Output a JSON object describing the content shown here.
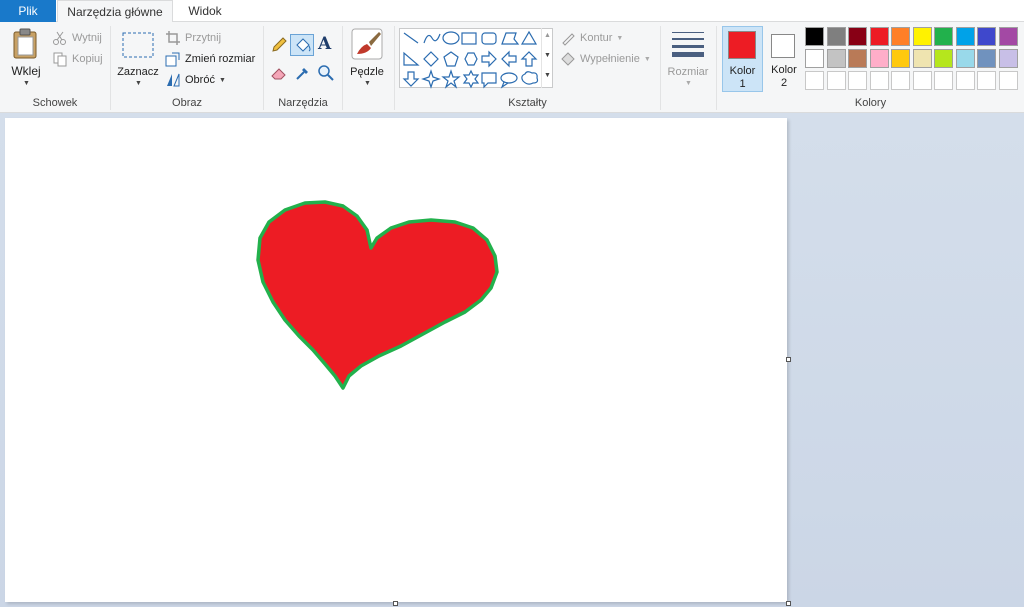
{
  "tabs": {
    "file": "Plik",
    "home": "Narzędzia główne",
    "view": "Widok"
  },
  "clipboard": {
    "paste": "Wklej",
    "cut": "Wytnij",
    "copy": "Kopiuj",
    "group": "Schowek"
  },
  "image": {
    "select": "Zaznacz",
    "crop": "Przytnij",
    "resize": "Zmień rozmiar",
    "rotate": "Obróć",
    "group": "Obraz"
  },
  "tools": {
    "group": "Narzędzia",
    "brushes": "Pędzle"
  },
  "shapes": {
    "outline": "Kontur",
    "fill": "Wypełnienie",
    "group": "Kształty"
  },
  "size": {
    "label": "Rozmiar"
  },
  "colors": {
    "color1_line1": "Kolor",
    "color1_line2": "1",
    "color2_line1": "Kolor",
    "color2_line2": "2",
    "group": "Kolory",
    "color1_value": "#ed1c24",
    "color2_value": "#ffffff",
    "palette_row1": [
      "#000000",
      "#7f7f7f",
      "#880015",
      "#ed1c24",
      "#ff7f27",
      "#fff200",
      "#22b14c",
      "#00a2e8",
      "#3f48cc",
      "#a349a4"
    ],
    "palette_row2": [
      "#ffffff",
      "#c3c3c3",
      "#b97a57",
      "#ffaec9",
      "#ffc90e",
      "#efe4b0",
      "#b5e61d",
      "#99d9ea",
      "#7092be",
      "#c8bfe7"
    ],
    "palette_row3": [
      "#ffffff",
      "#ffffff",
      "#ffffff",
      "#ffffff",
      "#ffffff",
      "#ffffff",
      "#ffffff",
      "#ffffff",
      "#ffffff",
      "#ffffff"
    ]
  },
  "canvas": {
    "drawing": "heart",
    "fill_color": "#ed1c24",
    "outline_color": "#22b14c"
  }
}
